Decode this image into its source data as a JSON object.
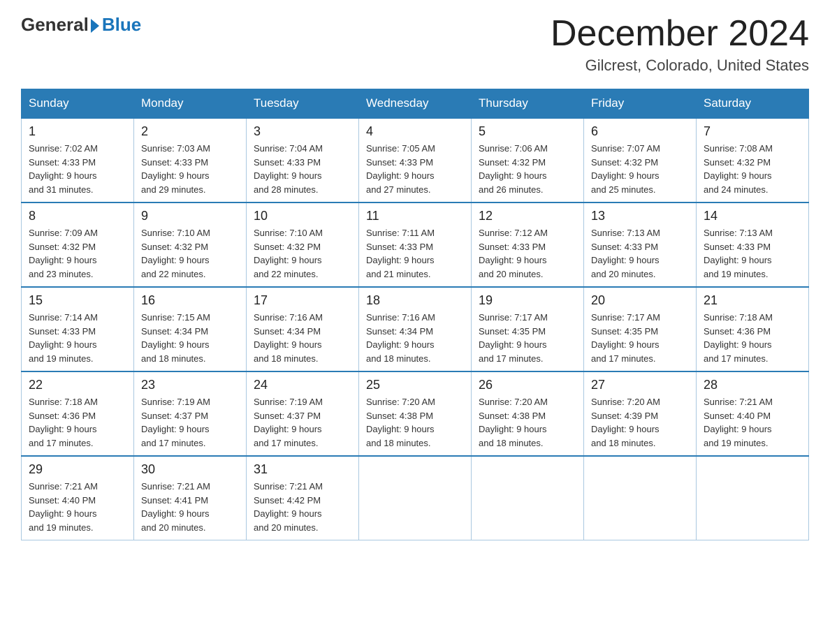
{
  "header": {
    "logo_general": "General",
    "logo_blue": "Blue",
    "month_title": "December 2024",
    "location": "Gilcrest, Colorado, United States"
  },
  "days_of_week": [
    "Sunday",
    "Monday",
    "Tuesday",
    "Wednesday",
    "Thursday",
    "Friday",
    "Saturday"
  ],
  "weeks": [
    [
      {
        "day": "1",
        "sunrise": "7:02 AM",
        "sunset": "4:33 PM",
        "daylight": "9 hours and 31 minutes."
      },
      {
        "day": "2",
        "sunrise": "7:03 AM",
        "sunset": "4:33 PM",
        "daylight": "9 hours and 29 minutes."
      },
      {
        "day": "3",
        "sunrise": "7:04 AM",
        "sunset": "4:33 PM",
        "daylight": "9 hours and 28 minutes."
      },
      {
        "day": "4",
        "sunrise": "7:05 AM",
        "sunset": "4:33 PM",
        "daylight": "9 hours and 27 minutes."
      },
      {
        "day": "5",
        "sunrise": "7:06 AM",
        "sunset": "4:32 PM",
        "daylight": "9 hours and 26 minutes."
      },
      {
        "day": "6",
        "sunrise": "7:07 AM",
        "sunset": "4:32 PM",
        "daylight": "9 hours and 25 minutes."
      },
      {
        "day": "7",
        "sunrise": "7:08 AM",
        "sunset": "4:32 PM",
        "daylight": "9 hours and 24 minutes."
      }
    ],
    [
      {
        "day": "8",
        "sunrise": "7:09 AM",
        "sunset": "4:32 PM",
        "daylight": "9 hours and 23 minutes."
      },
      {
        "day": "9",
        "sunrise": "7:10 AM",
        "sunset": "4:32 PM",
        "daylight": "9 hours and 22 minutes."
      },
      {
        "day": "10",
        "sunrise": "7:10 AM",
        "sunset": "4:32 PM",
        "daylight": "9 hours and 22 minutes."
      },
      {
        "day": "11",
        "sunrise": "7:11 AM",
        "sunset": "4:33 PM",
        "daylight": "9 hours and 21 minutes."
      },
      {
        "day": "12",
        "sunrise": "7:12 AM",
        "sunset": "4:33 PM",
        "daylight": "9 hours and 20 minutes."
      },
      {
        "day": "13",
        "sunrise": "7:13 AM",
        "sunset": "4:33 PM",
        "daylight": "9 hours and 20 minutes."
      },
      {
        "day": "14",
        "sunrise": "7:13 AM",
        "sunset": "4:33 PM",
        "daylight": "9 hours and 19 minutes."
      }
    ],
    [
      {
        "day": "15",
        "sunrise": "7:14 AM",
        "sunset": "4:33 PM",
        "daylight": "9 hours and 19 minutes."
      },
      {
        "day": "16",
        "sunrise": "7:15 AM",
        "sunset": "4:34 PM",
        "daylight": "9 hours and 18 minutes."
      },
      {
        "day": "17",
        "sunrise": "7:16 AM",
        "sunset": "4:34 PM",
        "daylight": "9 hours and 18 minutes."
      },
      {
        "day": "18",
        "sunrise": "7:16 AM",
        "sunset": "4:34 PM",
        "daylight": "9 hours and 18 minutes."
      },
      {
        "day": "19",
        "sunrise": "7:17 AM",
        "sunset": "4:35 PM",
        "daylight": "9 hours and 17 minutes."
      },
      {
        "day": "20",
        "sunrise": "7:17 AM",
        "sunset": "4:35 PM",
        "daylight": "9 hours and 17 minutes."
      },
      {
        "day": "21",
        "sunrise": "7:18 AM",
        "sunset": "4:36 PM",
        "daylight": "9 hours and 17 minutes."
      }
    ],
    [
      {
        "day": "22",
        "sunrise": "7:18 AM",
        "sunset": "4:36 PM",
        "daylight": "9 hours and 17 minutes."
      },
      {
        "day": "23",
        "sunrise": "7:19 AM",
        "sunset": "4:37 PM",
        "daylight": "9 hours and 17 minutes."
      },
      {
        "day": "24",
        "sunrise": "7:19 AM",
        "sunset": "4:37 PM",
        "daylight": "9 hours and 17 minutes."
      },
      {
        "day": "25",
        "sunrise": "7:20 AM",
        "sunset": "4:38 PM",
        "daylight": "9 hours and 18 minutes."
      },
      {
        "day": "26",
        "sunrise": "7:20 AM",
        "sunset": "4:38 PM",
        "daylight": "9 hours and 18 minutes."
      },
      {
        "day": "27",
        "sunrise": "7:20 AM",
        "sunset": "4:39 PM",
        "daylight": "9 hours and 18 minutes."
      },
      {
        "day": "28",
        "sunrise": "7:21 AM",
        "sunset": "4:40 PM",
        "daylight": "9 hours and 19 minutes."
      }
    ],
    [
      {
        "day": "29",
        "sunrise": "7:21 AM",
        "sunset": "4:40 PM",
        "daylight": "9 hours and 19 minutes."
      },
      {
        "day": "30",
        "sunrise": "7:21 AM",
        "sunset": "4:41 PM",
        "daylight": "9 hours and 20 minutes."
      },
      {
        "day": "31",
        "sunrise": "7:21 AM",
        "sunset": "4:42 PM",
        "daylight": "9 hours and 20 minutes."
      },
      null,
      null,
      null,
      null
    ]
  ]
}
